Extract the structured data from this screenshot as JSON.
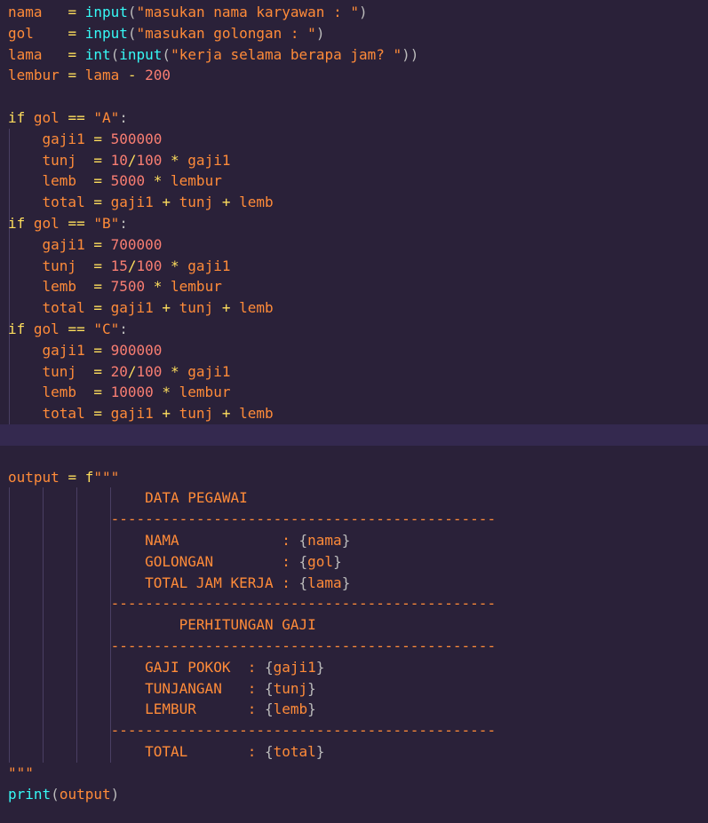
{
  "editor": {
    "theme": {
      "background": "#2a2139",
      "current_line": "#34294f",
      "indent_guide": "#4a3f63"
    },
    "lines": [
      [
        {
          "t": "nama   ",
          "c": "id"
        },
        {
          "t": "= ",
          "c": "op"
        },
        {
          "t": "input",
          "c": "fn"
        },
        {
          "t": "(",
          "c": "p"
        },
        {
          "t": "\"masukan nama karyawan : \"",
          "c": "str"
        },
        {
          "t": ")",
          "c": "p"
        }
      ],
      [
        {
          "t": "gol    ",
          "c": "id"
        },
        {
          "t": "= ",
          "c": "op"
        },
        {
          "t": "input",
          "c": "fn"
        },
        {
          "t": "(",
          "c": "p"
        },
        {
          "t": "\"masukan golongan : \"",
          "c": "str"
        },
        {
          "t": ")",
          "c": "p"
        }
      ],
      [
        {
          "t": "lama   ",
          "c": "id"
        },
        {
          "t": "= ",
          "c": "op"
        },
        {
          "t": "int",
          "c": "fn"
        },
        {
          "t": "(",
          "c": "p"
        },
        {
          "t": "input",
          "c": "fn"
        },
        {
          "t": "(",
          "c": "p"
        },
        {
          "t": "\"kerja selama berapa jam? \"",
          "c": "str"
        },
        {
          "t": "))",
          "c": "p"
        }
      ],
      [
        {
          "t": "lembur ",
          "c": "id"
        },
        {
          "t": "= ",
          "c": "op"
        },
        {
          "t": "lama ",
          "c": "id"
        },
        {
          "t": "- ",
          "c": "op"
        },
        {
          "t": "200",
          "c": "num"
        }
      ],
      [],
      [
        {
          "t": "if ",
          "c": "kw"
        },
        {
          "t": "gol ",
          "c": "id"
        },
        {
          "t": "== ",
          "c": "op"
        },
        {
          "t": "\"A\"",
          "c": "str"
        },
        {
          "t": ":",
          "c": "p"
        }
      ],
      [
        {
          "t": "    gaji1 ",
          "c": "id"
        },
        {
          "t": "= ",
          "c": "op"
        },
        {
          "t": "500000",
          "c": "num"
        }
      ],
      [
        {
          "t": "    tunj  ",
          "c": "id"
        },
        {
          "t": "= ",
          "c": "op"
        },
        {
          "t": "10",
          "c": "num"
        },
        {
          "t": "/",
          "c": "op"
        },
        {
          "t": "100 ",
          "c": "num"
        },
        {
          "t": "* ",
          "c": "op"
        },
        {
          "t": "gaji1",
          "c": "id"
        }
      ],
      [
        {
          "t": "    lemb  ",
          "c": "id"
        },
        {
          "t": "= ",
          "c": "op"
        },
        {
          "t": "5000 ",
          "c": "num"
        },
        {
          "t": "* ",
          "c": "op"
        },
        {
          "t": "lembur",
          "c": "id"
        }
      ],
      [
        {
          "t": "    total ",
          "c": "id"
        },
        {
          "t": "= ",
          "c": "op"
        },
        {
          "t": "gaji1 ",
          "c": "id"
        },
        {
          "t": "+ ",
          "c": "op"
        },
        {
          "t": "tunj ",
          "c": "id"
        },
        {
          "t": "+ ",
          "c": "op"
        },
        {
          "t": "lemb",
          "c": "id"
        }
      ],
      [
        {
          "t": "if ",
          "c": "kw"
        },
        {
          "t": "gol ",
          "c": "id"
        },
        {
          "t": "== ",
          "c": "op"
        },
        {
          "t": "\"B\"",
          "c": "str"
        },
        {
          "t": ":",
          "c": "p"
        }
      ],
      [
        {
          "t": "    gaji1 ",
          "c": "id"
        },
        {
          "t": "= ",
          "c": "op"
        },
        {
          "t": "700000",
          "c": "num"
        }
      ],
      [
        {
          "t": "    tunj  ",
          "c": "id"
        },
        {
          "t": "= ",
          "c": "op"
        },
        {
          "t": "15",
          "c": "num"
        },
        {
          "t": "/",
          "c": "op"
        },
        {
          "t": "100 ",
          "c": "num"
        },
        {
          "t": "* ",
          "c": "op"
        },
        {
          "t": "gaji1",
          "c": "id"
        }
      ],
      [
        {
          "t": "    lemb  ",
          "c": "id"
        },
        {
          "t": "= ",
          "c": "op"
        },
        {
          "t": "7500 ",
          "c": "num"
        },
        {
          "t": "* ",
          "c": "op"
        },
        {
          "t": "lembur",
          "c": "id"
        }
      ],
      [
        {
          "t": "    total ",
          "c": "id"
        },
        {
          "t": "= ",
          "c": "op"
        },
        {
          "t": "gaji1 ",
          "c": "id"
        },
        {
          "t": "+ ",
          "c": "op"
        },
        {
          "t": "tunj ",
          "c": "id"
        },
        {
          "t": "+ ",
          "c": "op"
        },
        {
          "t": "lemb",
          "c": "id"
        }
      ],
      [
        {
          "t": "if ",
          "c": "kw"
        },
        {
          "t": "gol ",
          "c": "id"
        },
        {
          "t": "== ",
          "c": "op"
        },
        {
          "t": "\"C\"",
          "c": "str"
        },
        {
          "t": ":",
          "c": "p"
        }
      ],
      [
        {
          "t": "    gaji1 ",
          "c": "id"
        },
        {
          "t": "= ",
          "c": "op"
        },
        {
          "t": "900000",
          "c": "num"
        }
      ],
      [
        {
          "t": "    tunj  ",
          "c": "id"
        },
        {
          "t": "= ",
          "c": "op"
        },
        {
          "t": "20",
          "c": "num"
        },
        {
          "t": "/",
          "c": "op"
        },
        {
          "t": "100 ",
          "c": "num"
        },
        {
          "t": "* ",
          "c": "op"
        },
        {
          "t": "gaji1",
          "c": "id"
        }
      ],
      [
        {
          "t": "    lemb  ",
          "c": "id"
        },
        {
          "t": "= ",
          "c": "op"
        },
        {
          "t": "10000 ",
          "c": "num"
        },
        {
          "t": "* ",
          "c": "op"
        },
        {
          "t": "lembur",
          "c": "id"
        }
      ],
      [
        {
          "t": "    total ",
          "c": "id"
        },
        {
          "t": "= ",
          "c": "op"
        },
        {
          "t": "gaji1 ",
          "c": "id"
        },
        {
          "t": "+ ",
          "c": "op"
        },
        {
          "t": "tunj ",
          "c": "id"
        },
        {
          "t": "+ ",
          "c": "op"
        },
        {
          "t": "lemb",
          "c": "id"
        }
      ],
      [],
      [],
      [
        {
          "t": "output ",
          "c": "id"
        },
        {
          "t": "= ",
          "c": "op"
        },
        {
          "t": "f",
          "c": "kw"
        },
        {
          "t": "\"\"\"",
          "c": "str"
        }
      ],
      [
        {
          "t": "                DATA PEGAWAI",
          "c": "str"
        }
      ],
      [
        {
          "t": "            ---------------------------------------------",
          "c": "str"
        }
      ],
      [
        {
          "t": "                NAMA            : ",
          "c": "str"
        },
        {
          "t": "{",
          "c": "p"
        },
        {
          "t": "nama",
          "c": "id"
        },
        {
          "t": "}",
          "c": "p"
        }
      ],
      [
        {
          "t": "                GOLONGAN        : ",
          "c": "str"
        },
        {
          "t": "{",
          "c": "p"
        },
        {
          "t": "gol",
          "c": "id"
        },
        {
          "t": "}",
          "c": "p"
        }
      ],
      [
        {
          "t": "                TOTAL JAM KERJA : ",
          "c": "str"
        },
        {
          "t": "{",
          "c": "p"
        },
        {
          "t": "lama",
          "c": "id"
        },
        {
          "t": "}",
          "c": "p"
        }
      ],
      [
        {
          "t": "            ---------------------------------------------",
          "c": "str"
        }
      ],
      [
        {
          "t": "                    PERHITUNGAN GAJI",
          "c": "str"
        }
      ],
      [
        {
          "t": "            ---------------------------------------------",
          "c": "str"
        }
      ],
      [
        {
          "t": "                GAJI POKOK  : ",
          "c": "str"
        },
        {
          "t": "{",
          "c": "p"
        },
        {
          "t": "gaji1",
          "c": "id"
        },
        {
          "t": "}",
          "c": "p"
        }
      ],
      [
        {
          "t": "                TUNJANGAN   : ",
          "c": "str"
        },
        {
          "t": "{",
          "c": "p"
        },
        {
          "t": "tunj",
          "c": "id"
        },
        {
          "t": "}",
          "c": "p"
        }
      ],
      [
        {
          "t": "                LEMBUR      : ",
          "c": "str"
        },
        {
          "t": "{",
          "c": "p"
        },
        {
          "t": "lemb",
          "c": "id"
        },
        {
          "t": "}",
          "c": "p"
        }
      ],
      [
        {
          "t": "            ---------------------------------------------",
          "c": "str"
        }
      ],
      [
        {
          "t": "                TOTAL       : ",
          "c": "str"
        },
        {
          "t": "{",
          "c": "p"
        },
        {
          "t": "total",
          "c": "id"
        },
        {
          "t": "}",
          "c": "p"
        }
      ],
      [
        {
          "t": "\"\"\"",
          "c": "str"
        }
      ],
      [
        {
          "t": "print",
          "c": "fn"
        },
        {
          "t": "(",
          "c": "p"
        },
        {
          "t": "output",
          "c": "id"
        },
        {
          "t": ")",
          "c": "p"
        }
      ]
    ],
    "current_line_index": 20
  }
}
